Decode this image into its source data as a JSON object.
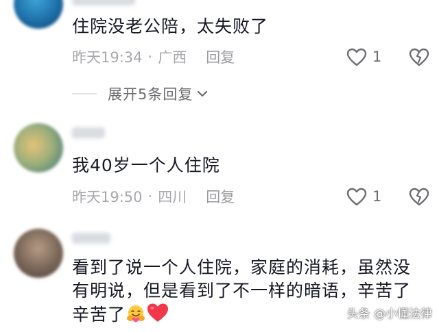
{
  "comments": [
    {
      "text": "住院没老公陪，太失败了",
      "time": "昨天19:34",
      "separator": "·",
      "location": "广西",
      "reply_label": "回复",
      "likes": "1"
    },
    {
      "text": "我40岁一个人住院",
      "time": "昨天19:50",
      "separator": "·",
      "location": "四川",
      "reply_label": "回复",
      "likes": "1"
    },
    {
      "text": "看到了说一个人住院，家庭的消耗，虽然没有明说，但是看到了不一样的暗语，辛苦了辛苦了"
    }
  ],
  "expand_replies": {
    "label": "展开5条回复"
  },
  "watermark": "头条 @小懂法律",
  "colors": {
    "text": "#161823",
    "meta": "#a6a7ab",
    "heart_emoji": "#f0384a"
  }
}
